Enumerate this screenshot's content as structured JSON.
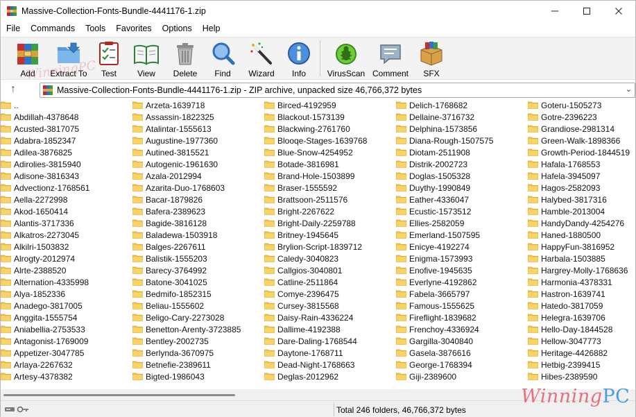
{
  "window": {
    "title": "Massive-Collection-Fonts-Bundle-4441176-1.zip"
  },
  "menu": [
    "File",
    "Commands",
    "Tools",
    "Favorites",
    "Options",
    "Help"
  ],
  "toolbar": [
    {
      "label": "Add",
      "icon": "archive-books-icon"
    },
    {
      "label": "Extract To",
      "icon": "folder-extract-icon"
    },
    {
      "label": "Test",
      "icon": "checklist-icon"
    },
    {
      "label": "View",
      "icon": "book-icon"
    },
    {
      "label": "Delete",
      "icon": "trash-icon"
    },
    {
      "label": "Find",
      "icon": "magnifier-icon"
    },
    {
      "label": "Wizard",
      "icon": "magic-wand-icon"
    },
    {
      "label": "Info",
      "icon": "info-icon"
    },
    {
      "label": "VirusScan",
      "icon": "bug-icon"
    },
    {
      "label": "Comment",
      "icon": "comment-icon"
    },
    {
      "label": "SFX",
      "icon": "sfx-box-icon"
    }
  ],
  "address": "Massive-Collection-Fonts-Bundle-4441176-1.zip - ZIP archive, unpacked size 46,766,372 bytes",
  "status": "Total 246 folders, 46,766,372 bytes",
  "watermark": {
    "main_word": "Winning",
    "main_suffix": "PC",
    "top": "WinningPC"
  },
  "columns": [
    [
      "..",
      "Abdillah-4378648",
      "Acusted-3817075",
      "Adabra-1852347",
      "Adilea-3876825",
      "Adirolies-3815940",
      "Adisone-3816343",
      "Advectionz-1768561",
      "Aella-2272998",
      "Akod-1650414",
      "Alantis-3717336",
      "Alkatros-2273045",
      "Alkilri-1503832",
      "Alrogty-2012974",
      "Alrte-2388520",
      "Alternation-4335998",
      "Alya-1852336",
      "Anadego-3817005",
      "Anggita-1555754",
      "Aniabellia-2753533",
      "Antagonist-1769009",
      "Appetizer-3047785",
      "Arlaya-2267632",
      "Artesy-4378382"
    ],
    [
      "Arzeta-1639718",
      "Assassin-1822325",
      "Atalintar-1555613",
      "Augustine-1977360",
      "Autined-3815521",
      "Autogenic-1961630",
      "Azala-2012994",
      "Azarita-Duo-1768603",
      "Bacar-1879826",
      "Bafera-2389623",
      "Bagide-3816128",
      "Baladewa-1503918",
      "Balges-2267611",
      "Balistik-1555203",
      "Barecy-3764992",
      "Batone-3041025",
      "Bedmifo-1852315",
      "Beliau-1555602",
      "Beligo-Cary-2273028",
      "Benetton-Arenty-3723885",
      "Bentley-2002735",
      "Berlynda-3670975",
      "Betnefie-2389611",
      "Bigted-1986043"
    ],
    [
      "Birced-4192959",
      "Blackout-1573139",
      "Blackwing-2761760",
      "Blooqe-Stages-1639768",
      "Blue-Snow-4254952",
      "Botade-3816981",
      "Brand-Hole-1503899",
      "Braser-1555592",
      "Brattsoon-2511576",
      "Bright-2267622",
      "Bright-Daily-2259788",
      "Britney-1945645",
      "Brylion-Script-1839712",
      "Caledy-3040823",
      "Callgios-3040801",
      "Catline-2511864",
      "Comye-2396475",
      "Cursey-3815568",
      "Daisy-Rain-4336224",
      "Dallime-4192388",
      "Dare-Daling-1768544",
      "Daytone-1768711",
      "Dead-Night-1768663",
      "Deglas-2012962"
    ],
    [
      "Delich-1768682",
      "Dellaine-3716732",
      "Delphina-1573856",
      "Diana-Rough-1507575",
      "Diotam-2511908",
      "Distrik-2002723",
      "Doglas-1505328",
      "Duythy-1990849",
      "Eather-4336047",
      "Ecustic-1573512",
      "Ellies-2582059",
      "Emerland-1507595",
      "Enicye-4192274",
      "Enigma-1573993",
      "Enofive-1945635",
      "Everlyne-4192862",
      "Fabela-3665797",
      "Famous-1555625",
      "Fireflight-1839682",
      "Frenchoy-4336924",
      "Gargilla-3040840",
      "Gasela-3876616",
      "George-1768394",
      "Giji-2389600"
    ],
    [
      "Goteru-1505273",
      "Gotre-2396223",
      "Grandiose-2981314",
      "Green-Walk-1898366",
      "Growth-Period-1844519",
      "Hafala-1768553",
      "Hafela-3945097",
      "Hagos-2582093",
      "Halybed-3817316",
      "Hamble-2013004",
      "HandyDandy-4254276",
      "Haned-1880500",
      "HappyFun-3816952",
      "Harbala-1503885",
      "Hargrey-Molly-1768636",
      "Harmonia-4378331",
      "Hastron-1639741",
      "Hatedo-3817059",
      "Helegra-1639706",
      "Hello-Day-1844528",
      "Hellow-3047773",
      "Heritage-4426882",
      "Hetbig-2399415",
      "Hibes-2389590"
    ]
  ]
}
